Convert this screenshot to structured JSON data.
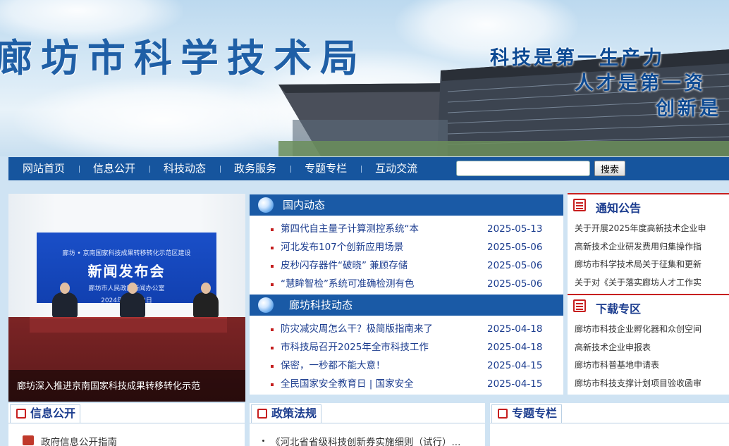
{
  "header": {
    "site_title": "廊坊市科学技术局",
    "slogan_lines": [
      "科技是第一生产力",
      "人才是第一资",
      "创新是"
    ]
  },
  "nav": {
    "items": [
      "网站首页",
      "信息公开",
      "科技动态",
      "政务服务",
      "专题专栏",
      "互动交流"
    ],
    "search_placeholder": "",
    "search_button": "搜索"
  },
  "photo": {
    "screen_line1": "廊坊 • 京南国家科技成果转移转化示范区建设",
    "screen_title": "新闻发布会",
    "screen_line2": "廊坊市人民政府新闻办公室",
    "screen_line3": "2024年12月12日",
    "caption": "廊坊深入推进京南国家科技成果转移转化示范"
  },
  "domestic_news": {
    "heading": "国内动态",
    "items": [
      {
        "title": "第四代自主量子计算测控系统“本",
        "date": "2025-05-13"
      },
      {
        "title": "河北发布107个创新应用场景",
        "date": "2025-05-06"
      },
      {
        "title": "皮秒闪存器件“破晓” 兼顾存储",
        "date": "2025-05-06"
      },
      {
        "title": "“慧眸智检”系统可准确检测有色",
        "date": "2025-05-06"
      }
    ]
  },
  "langfang_news": {
    "heading": "廊坊科技动态",
    "items": [
      {
        "title": "防灾减灾周怎么干？极简版指南来了",
        "date": "2025-04-18"
      },
      {
        "title": "市科技局召开2025年全市科技工作",
        "date": "2025-04-18"
      },
      {
        "title": "保密，一秒都不能大意！",
        "date": "2025-04-15"
      },
      {
        "title": "全民国家安全教育日 | 国家安全",
        "date": "2025-04-15"
      }
    ]
  },
  "notices": {
    "heading": "通知公告",
    "items": [
      "关于开展2025年度高新技术企业申",
      "高新技术企业研发费用归集操作指",
      "廊坊市科学技术局关于征集和更新",
      "关于对《关于落实廊坊人才工作实"
    ]
  },
  "downloads": {
    "heading": "下载专区",
    "items": [
      "廊坊市科技企业孵化器和众创空间",
      "高新技术企业申报表",
      "廊坊市科普基地申请表",
      "廊坊市科技支撑计划项目验收函审"
    ]
  },
  "info_public": {
    "heading": "信息公开",
    "first_item": "政府信息公开指南"
  },
  "policy": {
    "heading": "政策法规",
    "first_item": "《河北省省级科技创新券实施细则（试行）..."
  },
  "special": {
    "heading": "专题专栏"
  }
}
